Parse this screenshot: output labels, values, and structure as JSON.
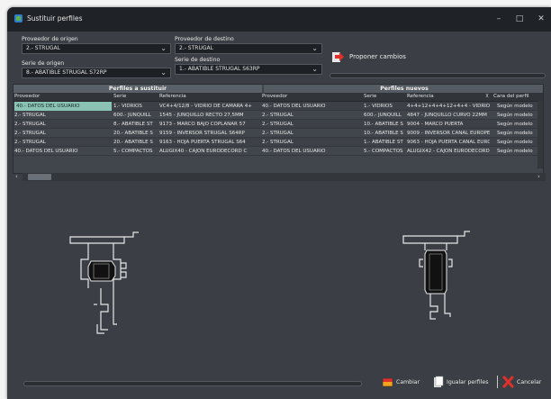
{
  "window": {
    "title": "Sustituir perfiles",
    "minimize": "–",
    "maximize": "□",
    "close": "✕"
  },
  "origin": {
    "supplier_label": "Proveedor de origen",
    "supplier_value": "2.- STRUGAL",
    "series_label": "Serie de origen",
    "series_value": "8.- ABATIBLE STRUGAL S72RP"
  },
  "destination": {
    "supplier_label": "Proveedor de destino",
    "supplier_value": "2.- STRUGAL",
    "series_label": "Serie de destino",
    "series_value": "1.- ABATIBLE STRUGAL S63RP"
  },
  "propose_label": "Proponer cambios",
  "grid": {
    "band_left": "Perfiles a sustituir",
    "band_right": "Perfiles nuevos",
    "headers": [
      "Proveedor",
      "Serie",
      "Referencia",
      "Proveedor",
      "Serie",
      "Referencia",
      "Cara del perfil"
    ],
    "rows": [
      [
        "40.- DATOS DEL USUARIO",
        "1.- VIDRIOS",
        "VC4+4/12/8 - VIDRIO DE CAMARA 4+",
        "40.- DATOS DEL USUARIO",
        "1.- VIDRIOS",
        "4+4+12+4+4+12+4+4 - VIDRIO 4",
        "Según modelo"
      ],
      [
        "2.- STRUGAL",
        "600.- JUNQUILL",
        "1545 - JUNQUILLO RECTO 27,5MM",
        "2.- STRUGAL",
        "600.- JUNQUILL",
        "4847 - JUNQUILLO CURVO 22MM",
        "Según modelo"
      ],
      [
        "2.- STRUGAL",
        "8.- ABATIBLE ST",
        "9173 - MARCO BAJO COPLANAR 57",
        "2.- STRUGAL",
        "10.- ABATIBLE S",
        "9004 - MARCO PUERTA",
        "Según modelo"
      ],
      [
        "2.- STRUGAL",
        "20.- ABATIBLE S",
        "9159 - INVERSOR STRUGAL S64RP",
        "2.- STRUGAL",
        "10.- ABATIBLE S",
        "9009 - INVERSOR CANAL EUROPEO",
        "Según modelo"
      ],
      [
        "2.- STRUGAL",
        "20.- ABATIBLE S",
        "9163 - HOJA PUERTA STRUGAL S64",
        "2.- STRUGAL",
        "1.- ABATIBLE ST",
        "9063 - HOJA PUERTA CANAL EUROP",
        "Según modelo"
      ],
      [
        "40.- DATOS DEL USUARIO",
        "5.- COMPACTOS",
        "ALUGIX40 - CAJON EURODECORD C",
        "40.- DATOS DEL USUARIO",
        "5.- COMPACTOS",
        "ALUGIX42 - CAJON EURODECORD C",
        "Según modelo"
      ]
    ]
  },
  "buttons": {
    "change": "Cambiar",
    "equalize": "Igualar perfiles",
    "cancel": "Cancelar"
  },
  "colors": {
    "accent_selection": "#8ac2b4",
    "window_bg": "#3b3f45"
  }
}
